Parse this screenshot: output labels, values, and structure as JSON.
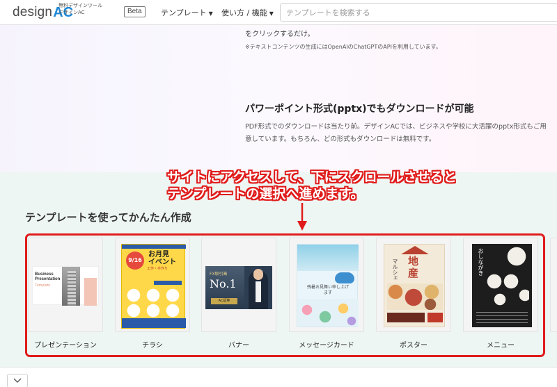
{
  "header": {
    "logo_word": "design",
    "logo_ac": "AC",
    "logo_sub_line1": "無料デザインツール",
    "logo_sub_line2": "デザインAC",
    "beta": "Beta",
    "nav": {
      "templates": "テンプレート",
      "howto": "使い方 / 機能"
    },
    "search_placeholder": "テンプレートを検索する"
  },
  "feature": {
    "line1": "をクリックするだけ。",
    "note": "※テキストコンテンツの生成にはOpenAIのChatGPTのAPIを利用しています。",
    "title": "パワーポイント形式(pptx)でもダウンロードが可能",
    "desc": "PDF形式でのダウンロードは当たり前。デザインACでは、ビジネスや学校に大活躍のpptx形式もご用意しています。もちろん、どの形式もダウンロードは無料です。"
  },
  "templates": {
    "section_title": "テンプレートを使ってかんたん作成",
    "cards": [
      {
        "label": "プレゼンテーション",
        "thumb_title": "Business\nPresentation",
        "thumb_sub": "Template"
      },
      {
        "label": "チラシ",
        "thumb_date": "9/16",
        "thumb_title": "お月見\nイベント",
        "thumb_sub": "工作・手作り"
      },
      {
        "label": "バナー",
        "thumb_fx": "FX取引高",
        "thumb_no1": "No.1",
        "thumb_btn": "AC証券"
      },
      {
        "label": "メッセージカード",
        "thumb_text": "残暑お見舞い申し上げます"
      },
      {
        "label": "ポスター",
        "thumb_big": "地\n産",
        "thumb_small": "マルシェ"
      },
      {
        "label": "メニュー",
        "thumb_title": "おしながき"
      }
    ]
  },
  "annotation": {
    "line1": "サイトにアクセスして、下にスクロールさせると",
    "line2": "テンプレートの選択へ進めます。",
    "color": "#e01b1b"
  },
  "icons": {
    "nav_caret": "caret-down-icon",
    "scroll": "chevron-down-icon"
  }
}
